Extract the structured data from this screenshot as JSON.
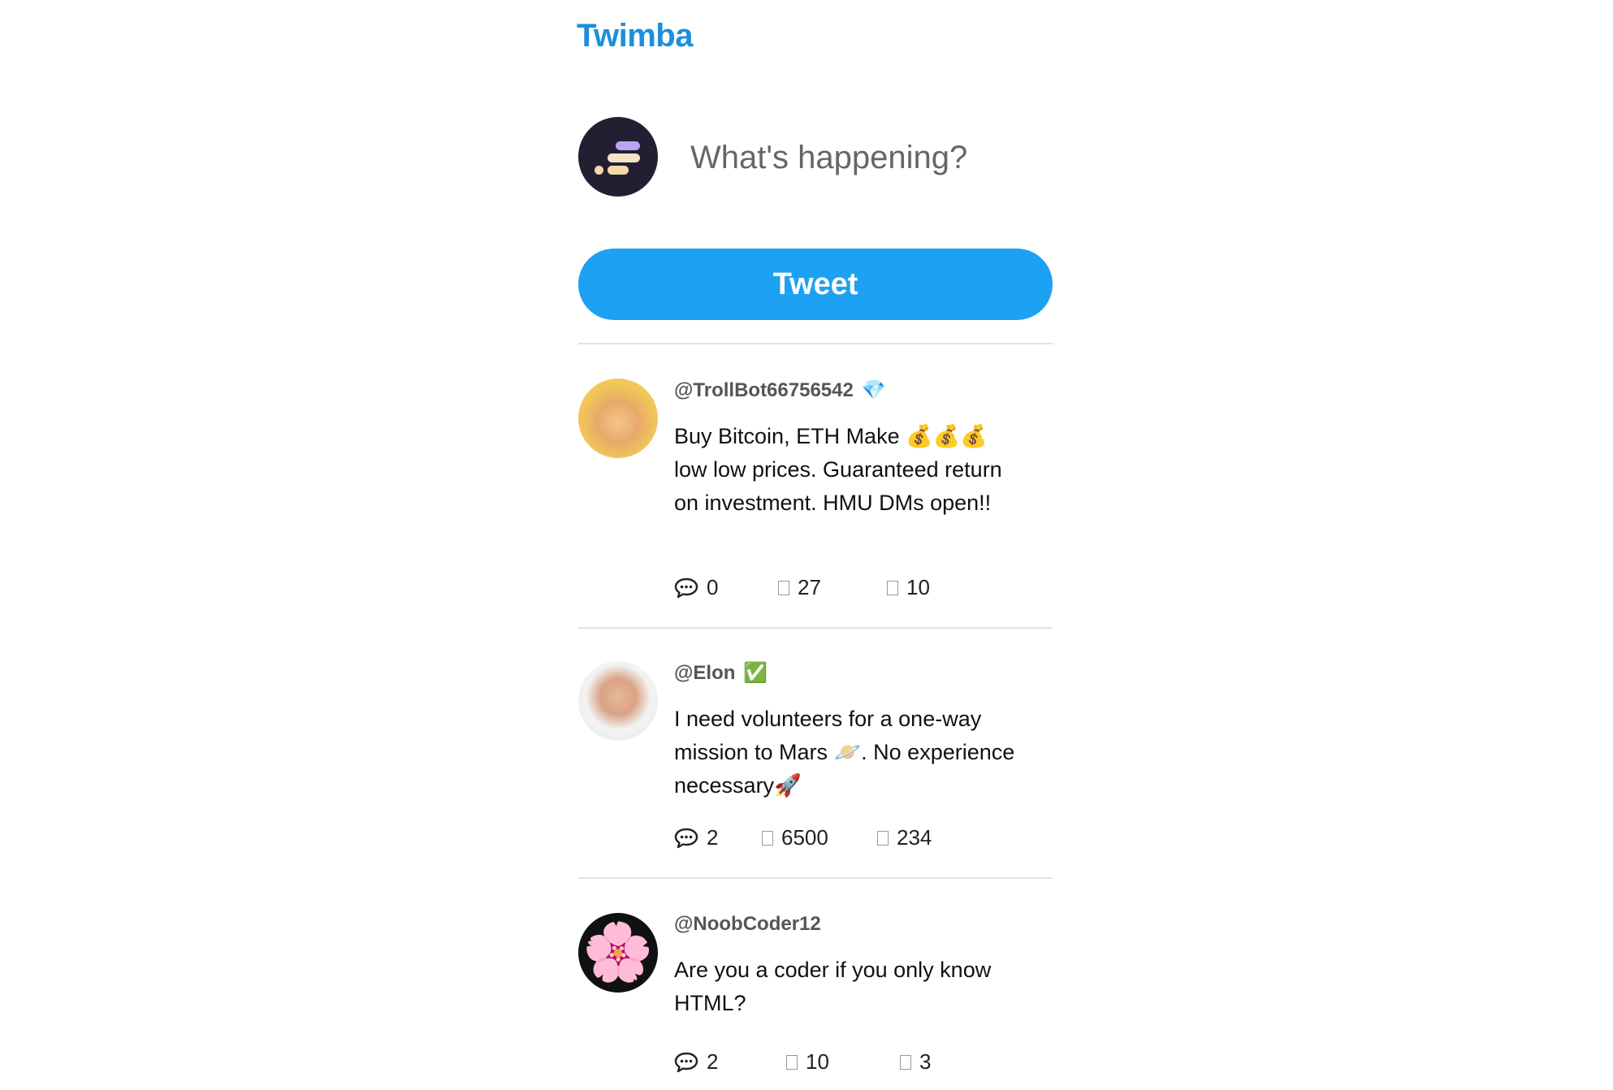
{
  "app": {
    "brand": "Twimba"
  },
  "composer": {
    "placeholder": "What's happening?",
    "tweet_label": "Tweet"
  },
  "tweets": [
    {
      "handle": "@TrollBot66756542",
      "badge": "💎",
      "text": "Buy Bitcoin, ETH Make 💰💰💰 low low prices. Guaranteed return on investment. HMU DMs open!!",
      "replies": "0",
      "likes": "27",
      "retweets": "10"
    },
    {
      "handle": "@Elon",
      "badge": "✅",
      "text": "I need volunteers for a one-way mission to Mars 🪐. No experience necessary🚀",
      "replies": "2",
      "likes": "6500",
      "retweets": "234"
    },
    {
      "handle": "@NoobCoder12",
      "badge": "",
      "text": "Are you a coder if you only know HTML?",
      "replies": "2",
      "likes": "10",
      "retweets": "3"
    }
  ],
  "colors": {
    "brand": "#1b8fdb",
    "button": "#1da1f2",
    "divider": "#e2e2e2"
  }
}
